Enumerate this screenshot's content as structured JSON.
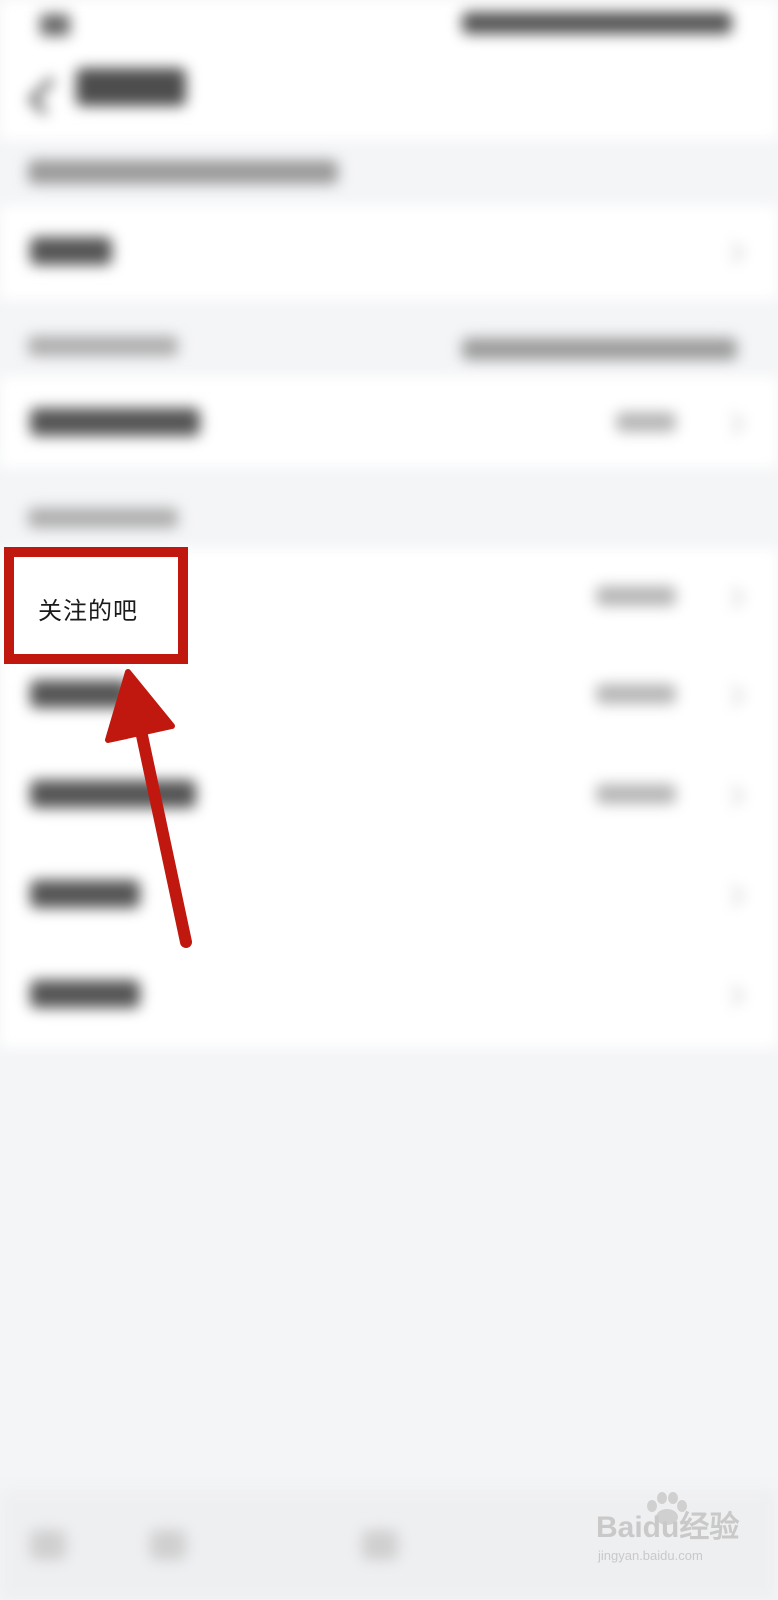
{
  "highlight": {
    "label": "关注的吧"
  },
  "watermark": {
    "brand": "Baidu经验",
    "domain": "jingyan.baidu.com"
  },
  "colors": {
    "annotation": "#c0170f",
    "background": "#f4f5f7",
    "row": "#ffffff"
  },
  "icons": [
    "back-icon",
    "chevron-right-icon",
    "annotation-arrow-icon",
    "baidu-paw-icon"
  ]
}
